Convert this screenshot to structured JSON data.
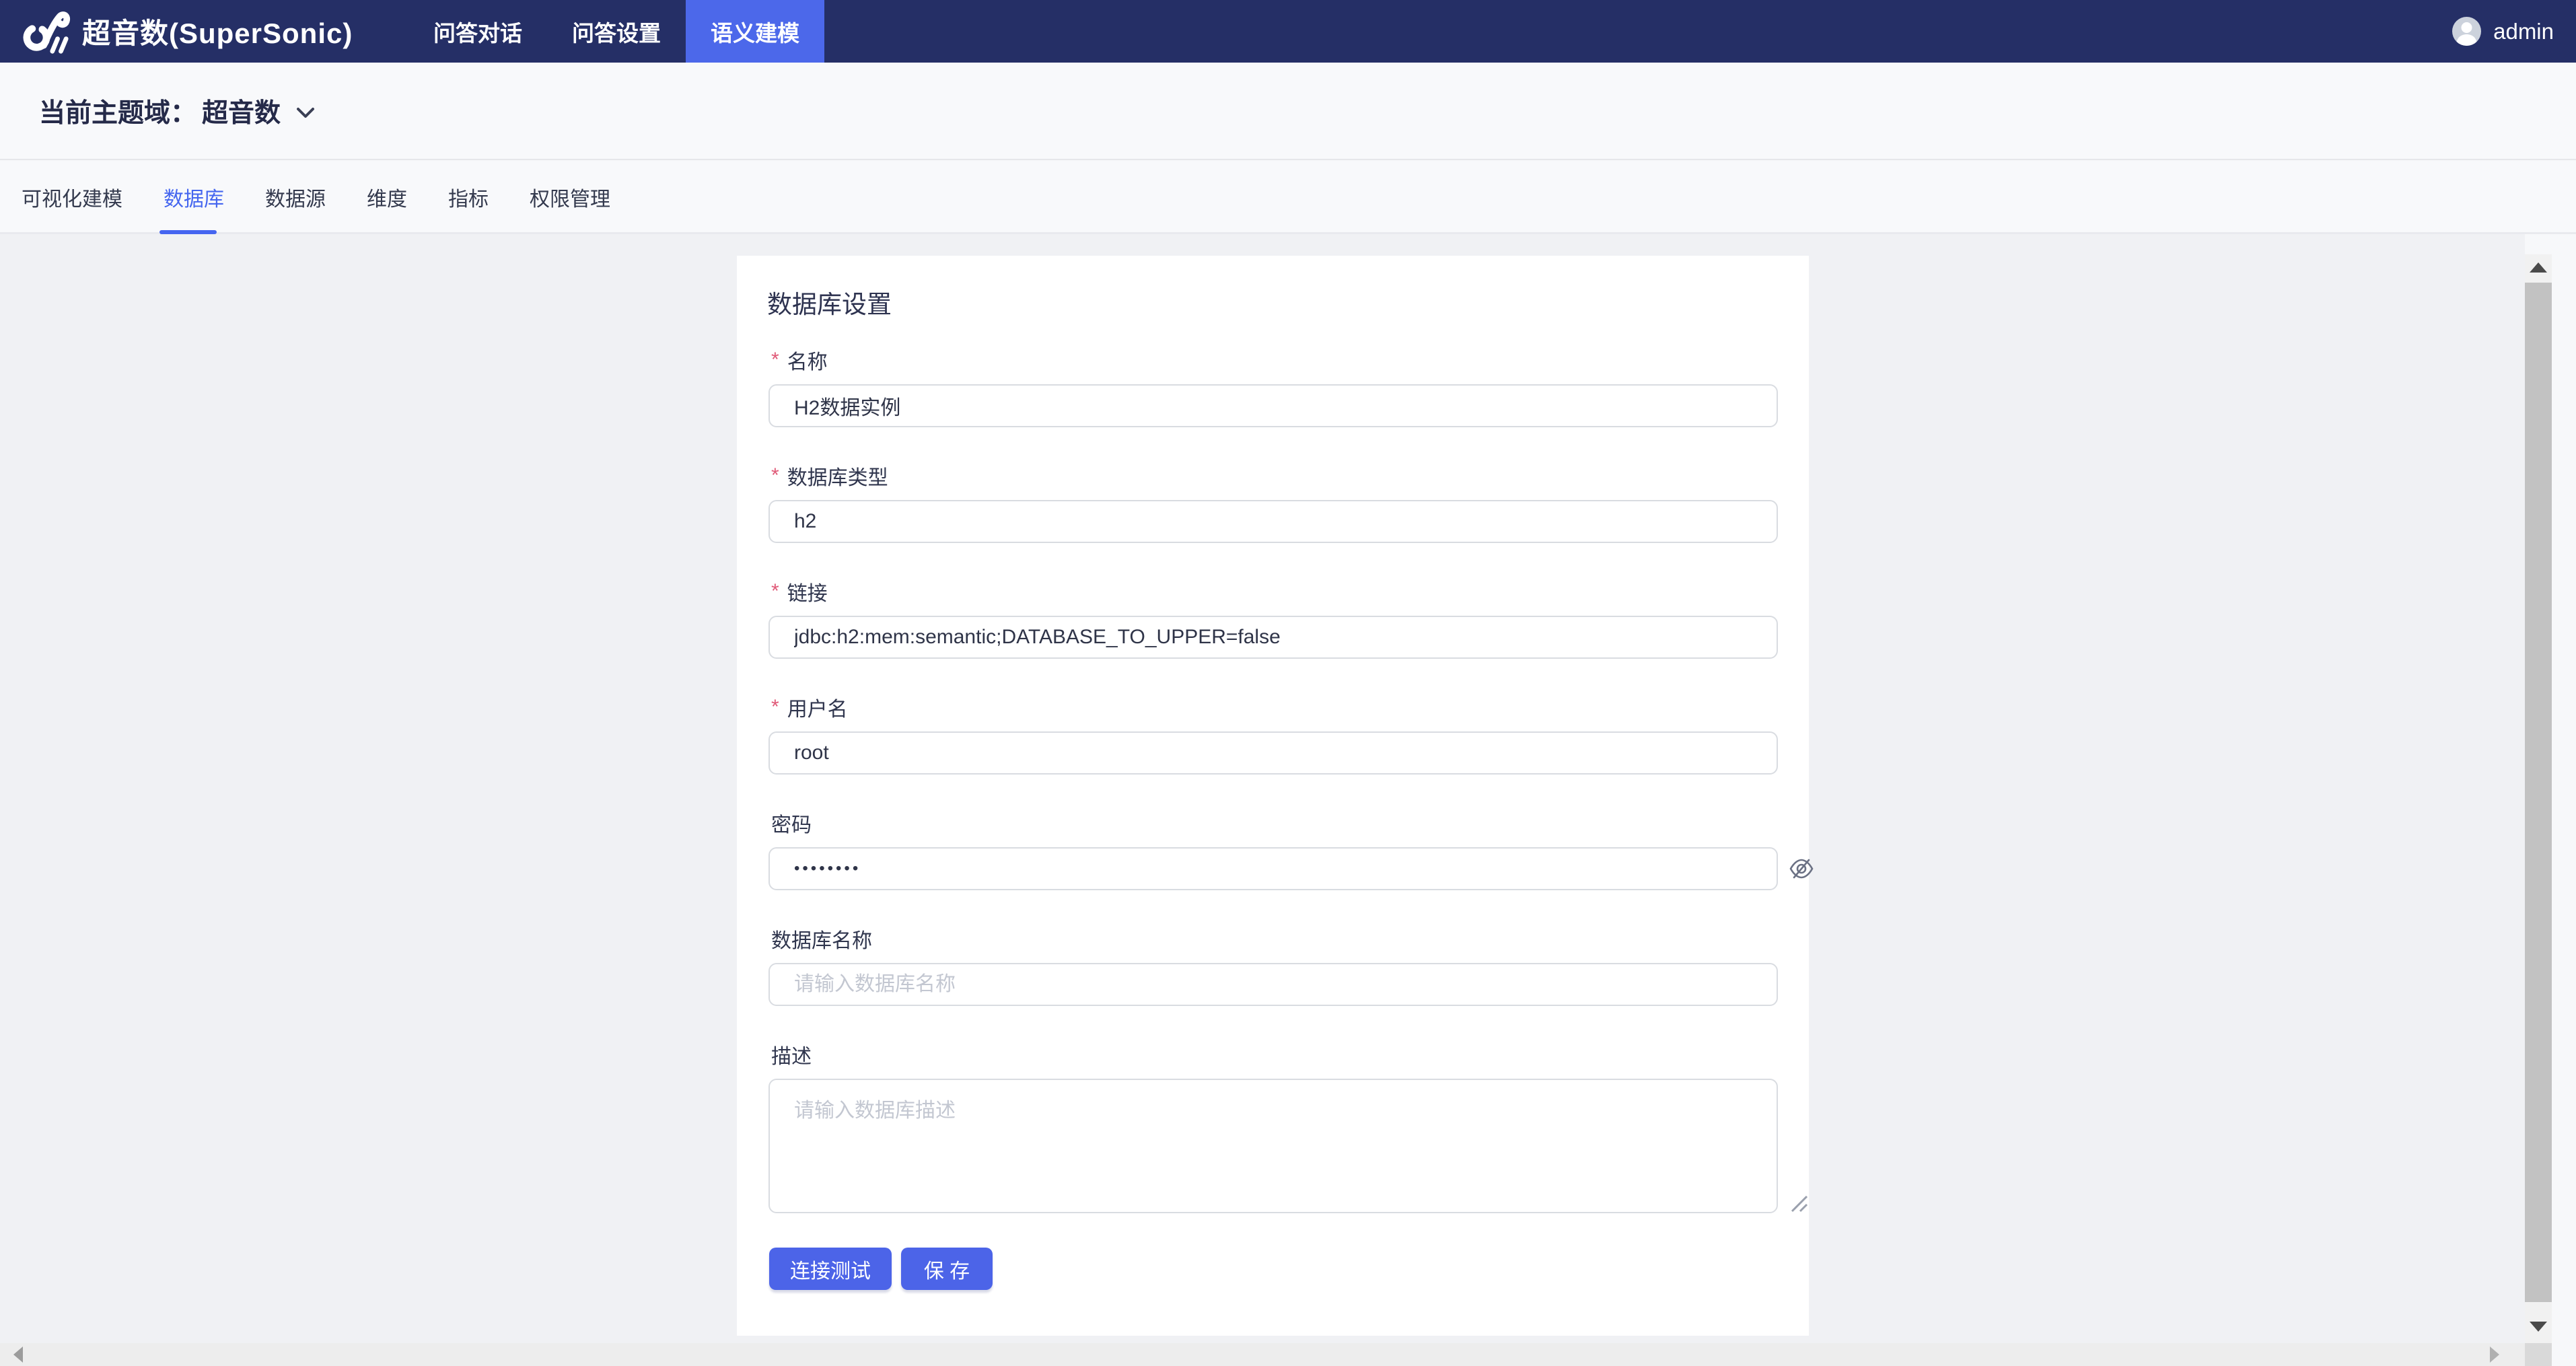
{
  "colors": {
    "navbar_bg": "#252f66",
    "nav_active_bg": "#4c68ea",
    "accent_blue": "#4c64e8",
    "tab_active_blue": "#4566ef",
    "required_red": "#e05a78",
    "content_bg": "#f0f1f4"
  },
  "navbar": {
    "brand": "超音数(SuperSonic)",
    "items": [
      {
        "label": "问答对话"
      },
      {
        "label": "问答设置"
      },
      {
        "label": "语义建模"
      }
    ],
    "active_index": 2,
    "user": {
      "name": "admin"
    }
  },
  "subheader": {
    "prefix": "当前主题域：",
    "value": "超音数"
  },
  "tabs": {
    "items": [
      {
        "label": "可视化建模"
      },
      {
        "label": "数据库"
      },
      {
        "label": "数据源"
      },
      {
        "label": "维度"
      },
      {
        "label": "指标"
      },
      {
        "label": "权限管理"
      }
    ],
    "active_index": 1
  },
  "form": {
    "title": "数据库设置",
    "required_mark": "*",
    "fields": {
      "name": {
        "label": "名称",
        "required": true,
        "value": "H2数据实例"
      },
      "type": {
        "label": "数据库类型",
        "required": true,
        "value": "h2"
      },
      "link": {
        "label": "链接",
        "required": true,
        "value": "jdbc:h2:mem:semantic;DATABASE_TO_UPPER=false"
      },
      "username": {
        "label": "用户名",
        "required": true,
        "value": "root"
      },
      "password": {
        "label": "密码",
        "required": false,
        "masked_value": "••••••••"
      },
      "database": {
        "label": "数据库名称",
        "required": false,
        "placeholder": "请输入数据库名称"
      },
      "description": {
        "label": "描述",
        "required": false,
        "placeholder": "请输入数据库描述"
      }
    },
    "buttons": {
      "test": "连接测试",
      "save": "保 存"
    }
  }
}
